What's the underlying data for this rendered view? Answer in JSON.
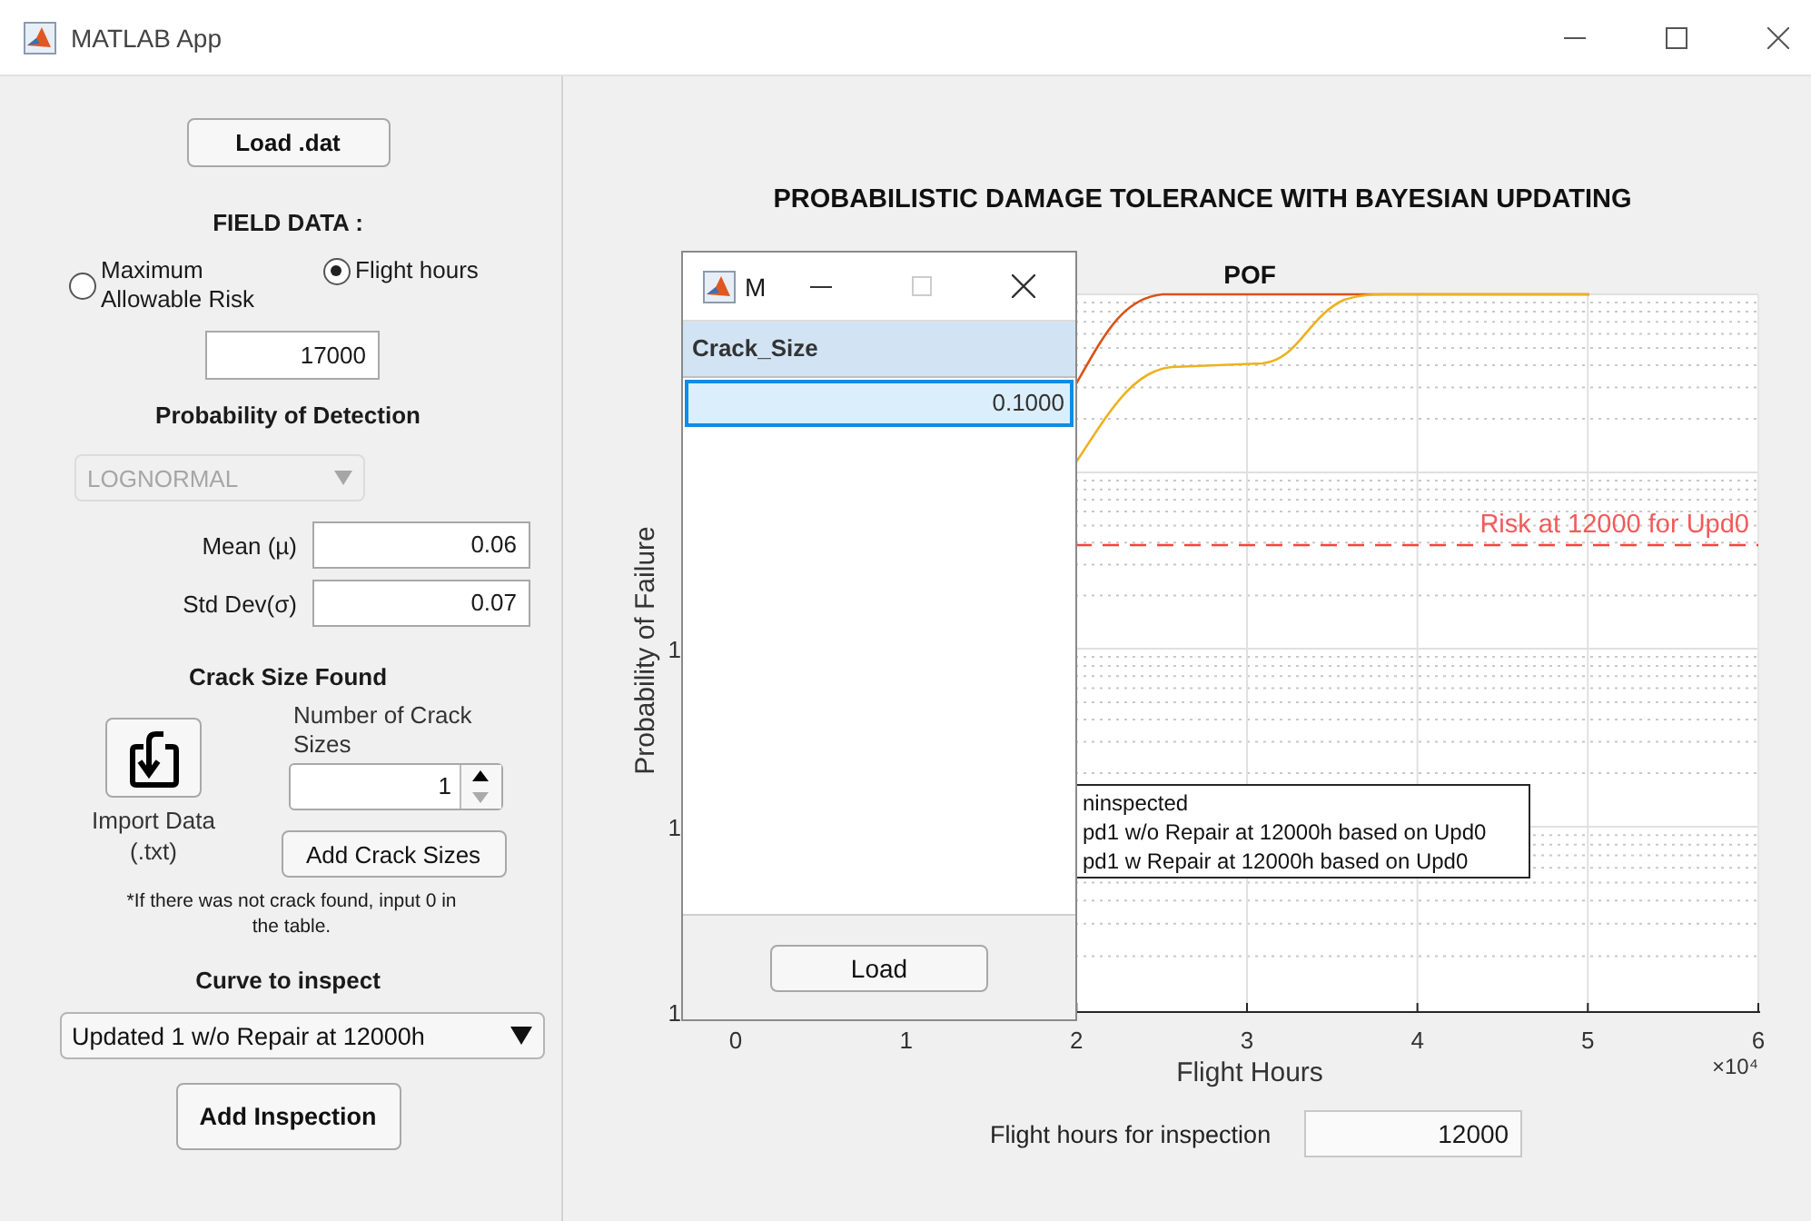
{
  "window": {
    "title": "MATLAB App"
  },
  "left_panel": {
    "load_button": "Load .dat",
    "field_data_heading": "FIELD DATA :",
    "radios": [
      {
        "label": "Maximum Allowable Risk",
        "selected": false
      },
      {
        "label": "Flight hours",
        "selected": true
      }
    ],
    "field_value": "17000",
    "pod_heading": "Probability of Detection",
    "pod_dropdown": {
      "value": "LOGNORMAL",
      "disabled": true
    },
    "params": [
      {
        "label": "Mean (µ)",
        "value": "0.06"
      },
      {
        "label": "Std Dev(σ)",
        "value": "0.07"
      }
    ],
    "crack_heading": "Crack Size Found",
    "import_label": "Import Data (.txt)",
    "count_label": "Number of Crack Sizes",
    "count_value": "1",
    "add_button": "Add Crack Sizes",
    "note": "*If there was not crack found, input 0 in the table.",
    "curve_heading": "Curve to inspect",
    "curve_dropdown": {
      "value": "Updated 1 w/o Repair at 12000h",
      "disabled": false
    },
    "inspection_button": "Add Inspection"
  },
  "chart": {
    "title": "PROBABILISTIC DAMAGE TOLERANCE WITH BAYESIAN UPDATING",
    "subtitle": "POF",
    "ylabel": "Probability of Failure",
    "xlabel": "Flight Hours",
    "x_multiplier": "×10⁴",
    "xticks": [
      "0",
      "1",
      "2",
      "3",
      "4",
      "5",
      "6"
    ],
    "yticks": [
      "1",
      "1",
      "1"
    ],
    "risk_label": "Risk at 12000 for Upd0",
    "legend": [
      "ninspected",
      "pd1 w/o Repair at 12000h based on Upd0",
      "pd1 w Repair at 12000h based on Upd0"
    ]
  },
  "inspection_hours": {
    "label": "Flight hours for inspection",
    "value": "12000"
  },
  "dialog": {
    "title": "M",
    "column": "Crack_Size",
    "rows": [
      {
        "value": "0.1000",
        "selected": true
      }
    ],
    "button": "Load"
  }
}
